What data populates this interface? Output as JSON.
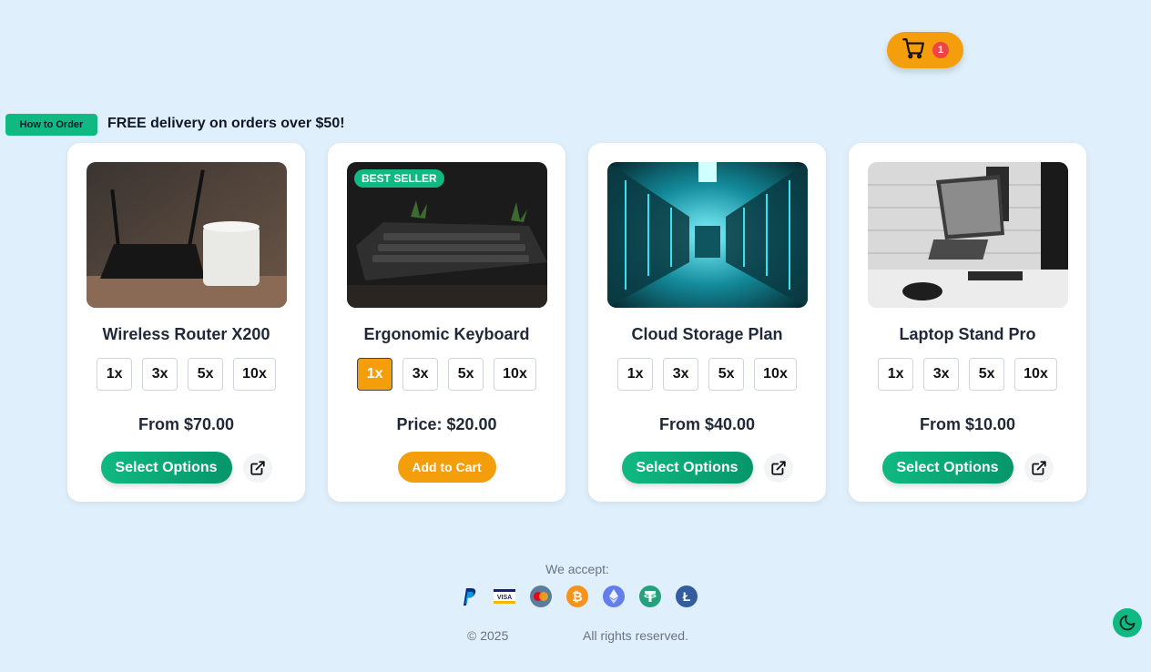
{
  "header": {
    "cart": {
      "icon": "cart-icon",
      "count": "1",
      "color": "#f59e0b"
    }
  },
  "announcement": {
    "how_to_order": "How to Order",
    "promo": "FREE delivery on orders over $50!"
  },
  "products": [
    {
      "name": "Wireless Router X200",
      "image": "router-image",
      "badge": "",
      "quantities": [
        "1x",
        "3x",
        "5x",
        "10x"
      ],
      "selected_quantity": "",
      "price": "From $70.00",
      "action": "Select Options",
      "has_external_link": true
    },
    {
      "name": "Ergonomic Keyboard",
      "image": "keyboard-image",
      "badge": "BEST SELLER",
      "quantities": [
        "1x",
        "3x",
        "5x",
        "10x"
      ],
      "selected_quantity": "1x",
      "price": "Price: $20.00",
      "action": "Add to Cart",
      "has_external_link": false
    },
    {
      "name": "Cloud Storage Plan",
      "image": "datacenter-image",
      "badge": "",
      "quantities": [
        "1x",
        "3x",
        "5x",
        "10x"
      ],
      "selected_quantity": "",
      "price": "From $40.00",
      "action": "Select Options",
      "has_external_link": true
    },
    {
      "name": "Laptop Stand Pro",
      "image": "laptop-stand-image",
      "badge": "",
      "quantities": [
        "1x",
        "3x",
        "5x",
        "10x"
      ],
      "selected_quantity": "",
      "price": "From $10.00",
      "action": "Select Options",
      "has_external_link": true
    }
  ],
  "footer": {
    "accept_label": "We accept:",
    "payment_methods": [
      "paypal-icon",
      "visa-icon",
      "mastercard-icon",
      "bitcoin-icon",
      "ethereum-icon",
      "tether-icon",
      "litecoin-icon"
    ],
    "copyright": "© 2025",
    "rights": "All rights reserved."
  },
  "theme_toggle": {
    "icon": "moon-icon"
  },
  "colors": {
    "background": "#dff0fc",
    "primary_green": "#10b981",
    "accent_orange": "#f59e0b",
    "badge_red": "#ef4444"
  }
}
